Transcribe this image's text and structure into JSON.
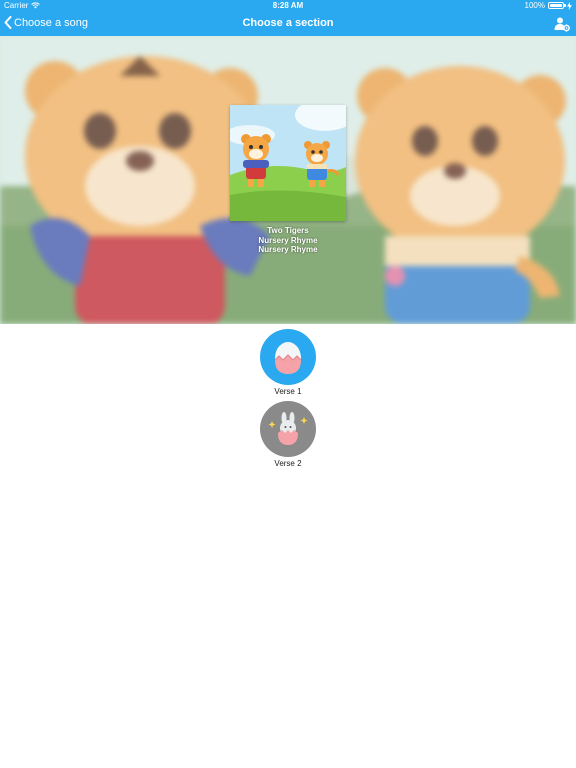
{
  "status_bar": {
    "carrier": "Carrier",
    "time": "8:28 AM",
    "battery": "100%",
    "wifi_icon": "wifi-icon",
    "battery_icon": "battery-icon",
    "charging_icon": "charging-icon"
  },
  "nav": {
    "back_label": "Choose a song",
    "back_icon": "chevron-left-icon",
    "title": "Choose a section",
    "profile_icon": "user-settings-icon"
  },
  "song": {
    "title": "Two Tigers",
    "subtitle_1": "Nursery Rhyme",
    "subtitle_2": "Nursery Rhyme"
  },
  "verses": [
    {
      "label": "Verse 1",
      "icon": "cracked-egg-icon",
      "color": "#2aa9f0"
    },
    {
      "label": "Verse 2",
      "icon": "bunny-egg-icon",
      "color": "#8a8a8a"
    }
  ],
  "colors": {
    "accent": "#2aa9f0",
    "verse_locked": "#8a8a8a"
  }
}
